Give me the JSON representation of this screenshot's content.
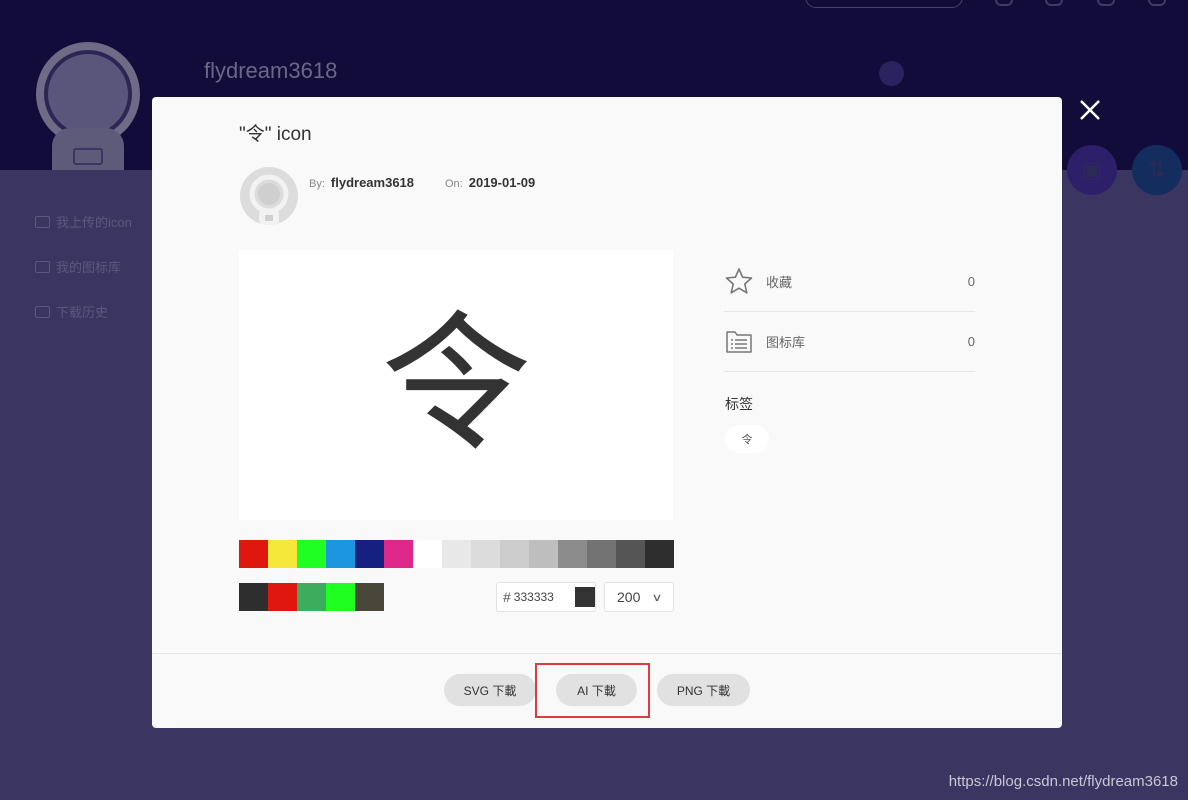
{
  "background": {
    "username": "flydream3618",
    "sidebar": [
      {
        "label": "我上传的icon",
        "icon": "cloud-upload-icon"
      },
      {
        "label": "我的图标库",
        "icon": "library-icon"
      },
      {
        "label": "下载历史",
        "icon": "download-icon"
      }
    ]
  },
  "modal": {
    "title": "\"令\" icon",
    "by_label": "By:",
    "author": "flydream3618",
    "on_label": "On:",
    "date": "2019-01-09",
    "icon_glyph": "令",
    "icon_color": "#333333",
    "palette_row1": [
      "#e0170e",
      "#f5e83a",
      "#1fff22",
      "#1b96df",
      "#16207f",
      "#dd2789",
      "#ffffff",
      "#e8e8e8",
      "#dcdcdc",
      "#cccccc",
      "#bebebe",
      "#8c8c8c",
      "#737373",
      "#555555",
      "#2e2e2e"
    ],
    "palette_row2": [
      "#2e2e2e",
      "#e0170e",
      "#3cac5d",
      "#1fff22",
      "#48473a"
    ],
    "hex_prefix": "#",
    "hex_value": "333333",
    "size_value": "200",
    "stats": {
      "favorite_label": "收藏",
      "favorite_count": "0",
      "library_label": "图标库",
      "library_count": "0"
    },
    "tags_heading": "标签",
    "tags": [
      "令"
    ],
    "buttons": {
      "svg": "SVG 下載",
      "ai": "AI 下載",
      "png": "PNG 下載"
    }
  },
  "watermark": "https://blog.csdn.net/flydream3618"
}
